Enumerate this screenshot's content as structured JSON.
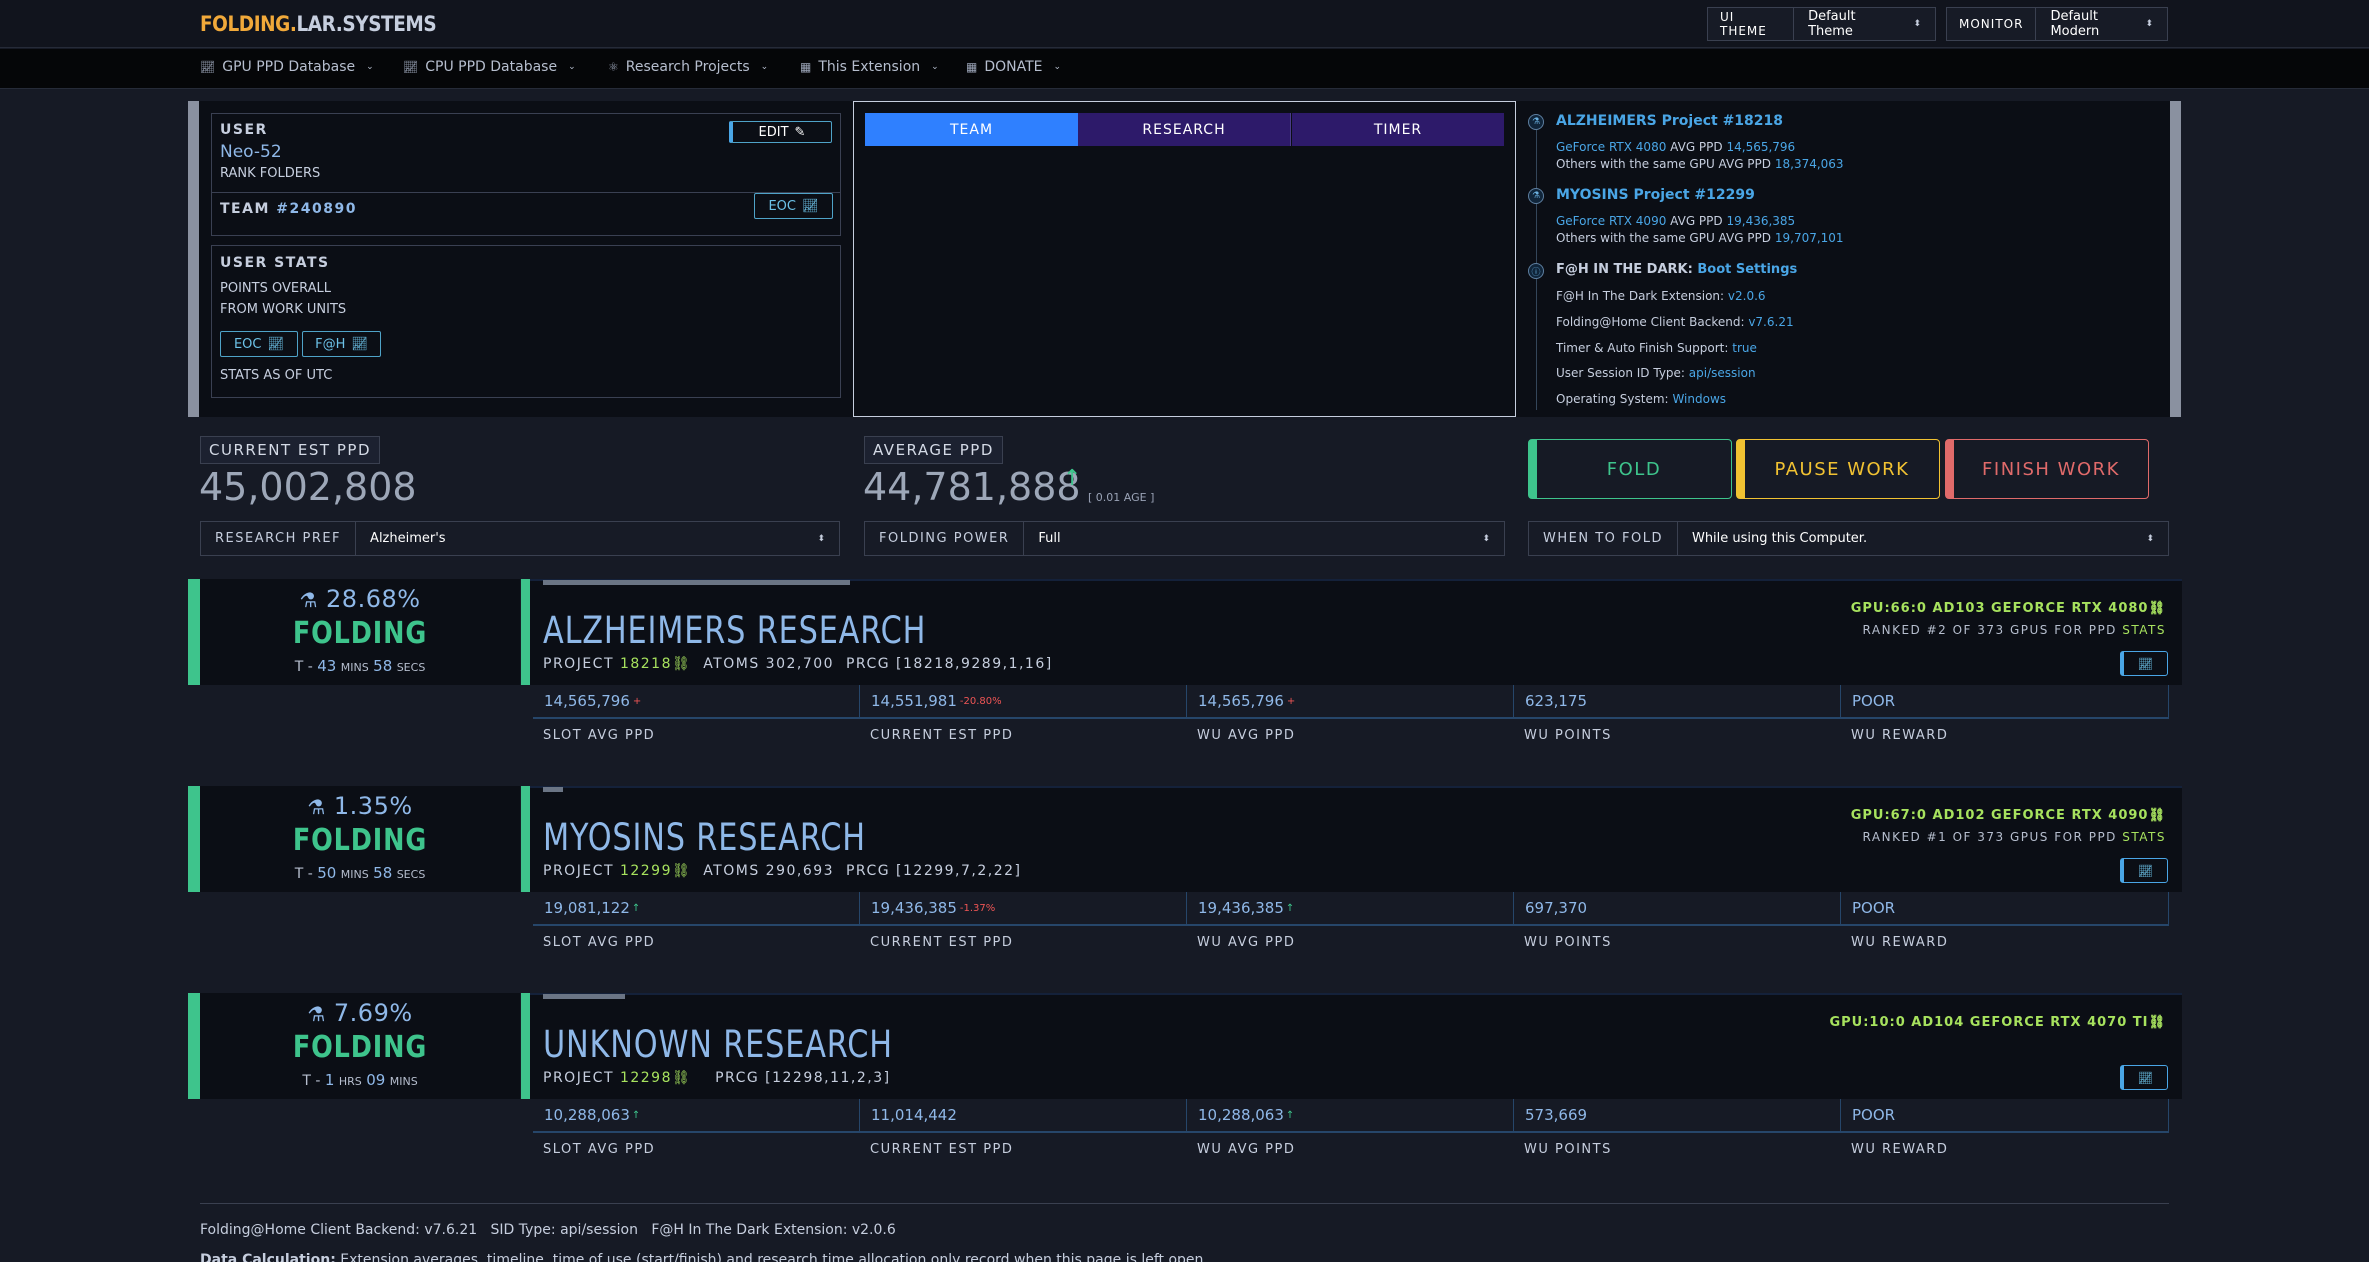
{
  "brand": {
    "part1": "FOLDING.",
    "part2": "LAR.SYSTEMS"
  },
  "header": {
    "ui_theme_label": "UI THEME",
    "ui_theme_value": "Default Theme",
    "monitor_label": "MONITOR",
    "monitor_value": "Default Modern"
  },
  "nav": [
    "GPU PPD Database",
    "CPU PPD Database",
    "Research Projects",
    "This Extension",
    "DONATE"
  ],
  "user": {
    "label": "USER",
    "name": "Neo-52",
    "rank": "RANK FOLDERS",
    "edit": "EDIT",
    "team_label": "TEAM",
    "team_number": "#240890",
    "eoc": "EOC",
    "stats_label": "USER STATS",
    "points_overall": "POINTS OVERALL",
    "from_wu": "FROM WORK UNITS",
    "eoc2": "EOC",
    "fah": "F@H",
    "stats_as_of": "STATS AS OF UTC"
  },
  "tabs": [
    "TEAM",
    "RESEARCH",
    "TIMER"
  ],
  "timeline": {
    "p1_title": "ALZHEIMERS Project #18218",
    "p1_gpu": "GeForce RTX 4080",
    "p1_avg_label": "AVG PPD",
    "p1_avg": "14,565,796",
    "p1_others": "Others with the same GPU AVG PPD",
    "p1_others_val": "18,374,063",
    "p2_title": "MYOSINS Project #12299",
    "p2_gpu": "GeForce RTX 4090",
    "p2_avg_label": "AVG PPD",
    "p2_avg": "19,436,385",
    "p2_others": "Others with the same GPU AVG PPD",
    "p2_others_val": "19,707,101",
    "dark_title": "F@H IN THE DARK:",
    "dark_link": "Boot Settings",
    "ext_label": "F@H In The Dark Extension:",
    "ext_val": "v2.0.6",
    "backend_label": "Folding@Home Client Backend:",
    "backend_val": "v7.6.21",
    "timer_label": "Timer & Auto Finish Support:",
    "timer_val": "true",
    "session_label": "User Session ID Type:",
    "session_val": "api/session",
    "os_label": "Operating System:",
    "os_val": "Windows"
  },
  "ppd": {
    "current_label": "CURRENT EST PPD",
    "current_value": "45,002,808",
    "average_label": "AVERAGE PPD",
    "average_value": "44,781,888",
    "average_age": "[ 0.01 AGE ]"
  },
  "actions": {
    "fold": "FOLD",
    "pause": "PAUSE WORK",
    "finish": "FINISH WORK"
  },
  "selects": {
    "research_label": "RESEARCH PREF",
    "research_value": "Alzheimer's",
    "power_label": "FOLDING POWER",
    "power_value": "Full",
    "when_label": "WHEN TO FOLD",
    "when_value": "While using this Computer."
  },
  "colors": {
    "accent": "#3ec48c",
    "blue": "#2f80ff",
    "purple": "#2d1a6a",
    "yellow": "#f1c232",
    "red": "#e06a6a"
  },
  "col_labels": [
    "SLOT AVG PPD",
    "CURRENT EST PPD",
    "WU AVG PPD",
    "WU POINTS",
    "WU REWARD"
  ],
  "slots": [
    {
      "progress": 0.2868,
      "pct": "28.68%",
      "status": "FOLDING",
      "eta_prefix": "T -",
      "eta_a": "43",
      "eta_a_unit": "MINS",
      "eta_b": "58",
      "eta_b_unit": "SECS",
      "title": "ALZHEIMERS RESEARCH",
      "project_label": "PROJECT",
      "project": "18218",
      "atoms_label": "ATOMS",
      "atoms": "302,700",
      "prcg_label": "PRCG",
      "prcg": "[18218,9289,1,16]",
      "gpu": "GPU:66:0 AD103 GEFORCE RTX 4080",
      "rank": "RANKED #2 OF 373 GPUS FOR PPD",
      "stats": "STATS",
      "values": [
        "14,565,796",
        "14,551,981",
        "14,565,796",
        "623,175",
        "POOR"
      ],
      "delta": "-20.80%"
    },
    {
      "progress": 0.0135,
      "pct": "1.35%",
      "status": "FOLDING",
      "eta_prefix": "T -",
      "eta_a": "50",
      "eta_a_unit": "MINS",
      "eta_b": "58",
      "eta_b_unit": "SECS",
      "title": "MYOSINS RESEARCH",
      "project_label": "PROJECT",
      "project": "12299",
      "atoms_label": "ATOMS",
      "atoms": "290,693",
      "prcg_label": "PRCG",
      "prcg": "[12299,7,2,22]",
      "gpu": "GPU:67:0 AD102 GEFORCE RTX 4090",
      "rank": "RANKED #1 OF 373 GPUS FOR PPD",
      "stats": "STATS",
      "values": [
        "19,081,122",
        "19,436,385",
        "19,436,385",
        "697,370",
        "POOR"
      ],
      "delta": "-1.37%"
    },
    {
      "progress": 0.0769,
      "pct": "7.69%",
      "status": "FOLDING",
      "eta_prefix": "T -",
      "eta_a": "1",
      "eta_a_unit": "HRS",
      "eta_b": "09",
      "eta_b_unit": "MINS",
      "title": "UNKNOWN RESEARCH",
      "project_label": "PROJECT",
      "project": "12298",
      "atoms_label": "",
      "atoms": "",
      "prcg_label": "PRCG",
      "prcg": "[12298,11,2,3]",
      "gpu": "GPU:10:0 AD104 GEFORCE RTX 4070 TI",
      "rank": "",
      "stats": "",
      "values": [
        "10,288,063",
        "11,014,442",
        "10,288,063",
        "573,669",
        "POOR"
      ],
      "delta": ""
    }
  ],
  "footer": {
    "line1": "Folding@Home Client Backend: v7.6.21   SID Type: api/session   F@H In The Dark Extension: v2.0.6",
    "line2_bold": "Data Calculation:",
    "line2": "Extension averages, timeline, time of use (start/finish) and research time allocation only record when this page is left open."
  }
}
